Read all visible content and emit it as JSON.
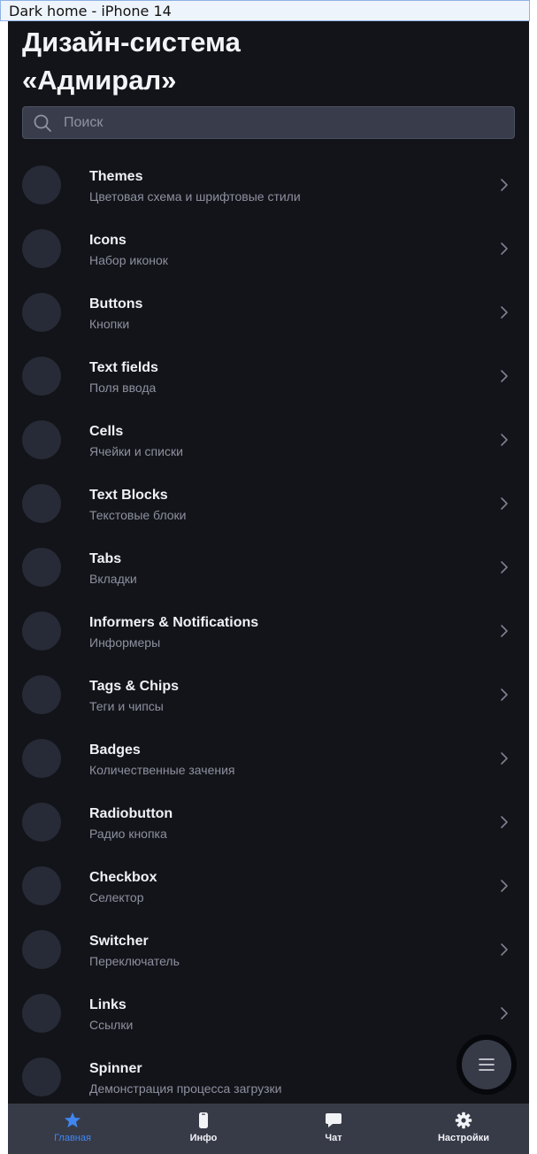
{
  "frame_label": "Dark home - iPhone 14",
  "header": {
    "title": "Дизайн-система «Адмирал»"
  },
  "search": {
    "placeholder": "Поиск",
    "icon": "search-icon"
  },
  "colors": {
    "background": "#131419",
    "surface": "#373b48",
    "accent": "#3f86f0",
    "text_primary": "#f0f1f6",
    "text_secondary": "#8d91a0"
  },
  "items": [
    {
      "name": "Themes",
      "desc": "Цветовая схема и шрифтовые стили"
    },
    {
      "name": "Icons",
      "desc": "Набор иконок"
    },
    {
      "name": "Buttons",
      "desc": "Кнопки"
    },
    {
      "name": "Text fields",
      "desc": "Поля ввода"
    },
    {
      "name": "Cells",
      "desc": "Ячейки и списки"
    },
    {
      "name": "Text Blocks",
      "desc": "Текстовые блоки"
    },
    {
      "name": "Tabs",
      "desc": "Вкладки"
    },
    {
      "name": "Informers & Notifications",
      "desc": "Информеры"
    },
    {
      "name": "Tags & Chips",
      "desc": "Теги и чипсы"
    },
    {
      "name": "Badges",
      "desc": "Количественные зачения"
    },
    {
      "name": "Radiobutton",
      "desc": "Радио кнопка"
    },
    {
      "name": "Checkbox",
      "desc": "Селектор"
    },
    {
      "name": "Switcher",
      "desc": "Переключатель"
    },
    {
      "name": "Links",
      "desc": "Ссылки"
    },
    {
      "name": "Spinner",
      "desc": "Демонстрация процесса загрузки"
    }
  ],
  "fab": {
    "icon": "menu-icon"
  },
  "tabbar": [
    {
      "label": "Главная",
      "icon": "star-icon",
      "active": true
    },
    {
      "label": "Инфо",
      "icon": "phone-icon",
      "active": false
    },
    {
      "label": "Чат",
      "icon": "chat-bubble-icon",
      "active": false
    },
    {
      "label": "Настройки",
      "icon": "gear-icon",
      "active": false
    }
  ]
}
